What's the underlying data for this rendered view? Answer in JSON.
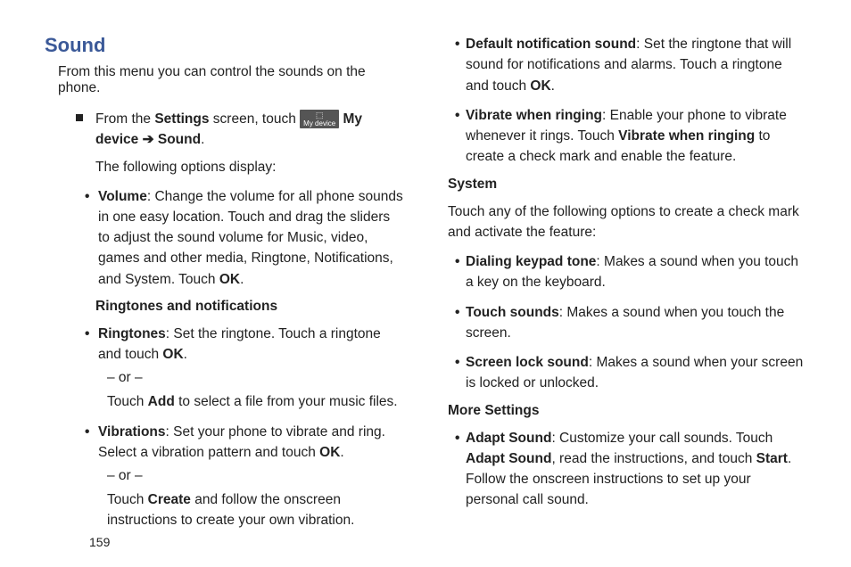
{
  "heading": "Sound",
  "intro": "From this menu you can control the sounds on the phone.",
  "step_prefix": "From the ",
  "step_settings": "Settings",
  "step_mid": " screen, touch ",
  "icon_label": "My device",
  "step_mydevice": " My device ",
  "step_arrow": "➔",
  "step_sound": "Sound",
  "step_period": ".",
  "subintro": "The following options display:",
  "volume_label": "Volume",
  "volume_text": ": Change the volume for all phone sounds in one easy location. Touch and drag the sliders to adjust the sound volume for Music, video, games and other media, Ringtone, Notifications, and System. Touch ",
  "volume_ok": "OK",
  "ringtones_heading": "Ringtones and notifications",
  "ringtones_label": "Ringtones",
  "ringtones_text": ": Set the ringtone. Touch a ringtone and touch ",
  "ringtones_ok": "OK",
  "or_text": "– or –",
  "ringtones_alt1": "Touch ",
  "ringtones_add": "Add",
  "ringtones_alt2": " to select a file from your music files.",
  "vibrations_label": "Vibrations",
  "vibrations_text": ": Set your phone to vibrate and ring. Select a vibration pattern and touch ",
  "vibrations_ok": "OK",
  "vibrations_alt1": "Touch ",
  "vibrations_create": "Create",
  "vibrations_alt2": " and follow the onscreen instructions to create your own vibration.",
  "default_label": "Default notification sound",
  "default_text": ": Set the ringtone that will sound for notifications and alarms. Touch a ringtone and touch ",
  "default_ok": "OK",
  "vibrate_ring_label": "Vibrate when ringing",
  "vibrate_ring_text1": ": Enable your phone to vibrate whenever it rings. Touch ",
  "vibrate_ring_bold": "Vibrate when ringing",
  "vibrate_ring_text2": " to create a check mark and enable the feature.",
  "system_heading": "System",
  "system_intro": "Touch any of the following options to create a check mark and activate the feature:",
  "dialing_label": "Dialing keypad tone",
  "dialing_text": ": Makes a sound when you touch a key on the keyboard.",
  "touch_sounds_label": "Touch sounds",
  "touch_sounds_text": ": Makes a sound when you touch the screen.",
  "screen_lock_label": "Screen lock sound",
  "screen_lock_text": ": Makes a sound when your screen is locked or unlocked.",
  "more_settings_heading": "More Settings",
  "adapt_label": "Adapt Sound",
  "adapt_text1": ": Customize your call sounds. Touch ",
  "adapt_bold1": "Adapt Sound",
  "adapt_text2": ", read the instructions, and touch ",
  "adapt_bold2": "Start",
  "adapt_text3": ". Follow the onscreen instructions to set up your personal call sound.",
  "page_number": "159"
}
